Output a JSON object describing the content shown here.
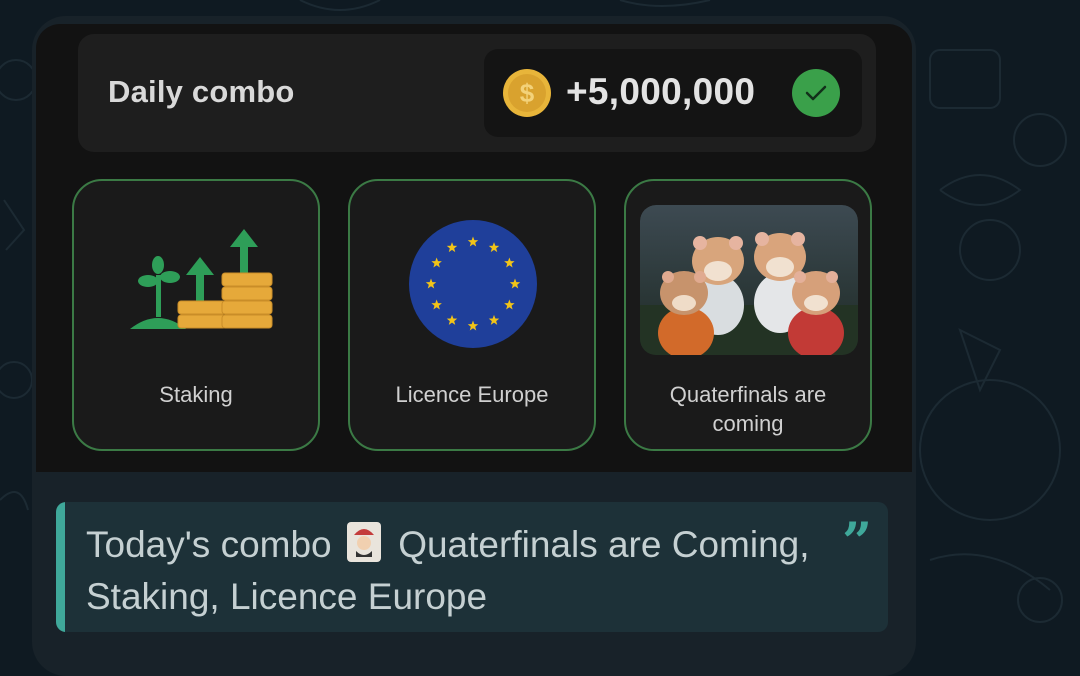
{
  "combo": {
    "title": "Daily combo",
    "reward": "+5,000,000",
    "icons": [
      "coin-icon",
      "check-icon"
    ]
  },
  "cards": [
    {
      "label": "Staking",
      "icon": "staking-icon"
    },
    {
      "label": "Licence Europe",
      "icon": "eu-flag-icon"
    },
    {
      "label_line1": "Quaterfinals are",
      "label_line2": "coming",
      "icon": "hamsters-image"
    }
  ],
  "message": {
    "text_before": "Today's combo",
    "emoji": "joker-card-icon",
    "text_after": "Quaterfinals are Coming, Staking, Licence Europe"
  },
  "colors": {
    "accent": "#3fa89a",
    "card_border": "#3b7a45",
    "coin": "#e8b53a",
    "check": "#3aa04a"
  }
}
